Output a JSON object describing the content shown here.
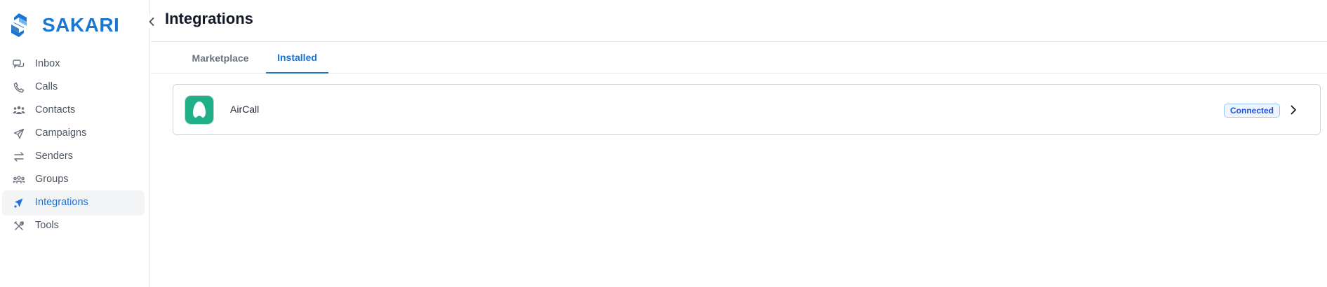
{
  "brand": {
    "name": "SAKARI",
    "logo_icon": "sakari-logo-icon",
    "color": "#1877d2"
  },
  "sidebar": {
    "items": [
      {
        "label": "Inbox",
        "icon": "chat-bubbles-icon",
        "active": false
      },
      {
        "label": "Calls",
        "icon": "phone-icon",
        "active": false
      },
      {
        "label": "Contacts",
        "icon": "people-icon",
        "active": false
      },
      {
        "label": "Campaigns",
        "icon": "paper-plane-icon",
        "active": false
      },
      {
        "label": "Senders",
        "icon": "swap-arrows-icon",
        "active": false
      },
      {
        "label": "Groups",
        "icon": "group-icon",
        "active": false
      },
      {
        "label": "Integrations",
        "icon": "integrations-icon",
        "active": true
      },
      {
        "label": "Tools",
        "icon": "tools-icon",
        "active": false
      }
    ],
    "collapse_icon": "chevron-left-icon"
  },
  "header": {
    "title": "Integrations"
  },
  "tabs": [
    {
      "label": "Marketplace",
      "active": false
    },
    {
      "label": "Installed",
      "active": true
    }
  ],
  "integrations": [
    {
      "name": "AirCall",
      "icon": "aircall-logo-icon",
      "status": "Connected",
      "icon_color": "#1fb08a"
    }
  ],
  "colors": {
    "accent": "#1a73d9",
    "badge_border": "#93c5fd",
    "badge_bg": "#eef5ff"
  }
}
